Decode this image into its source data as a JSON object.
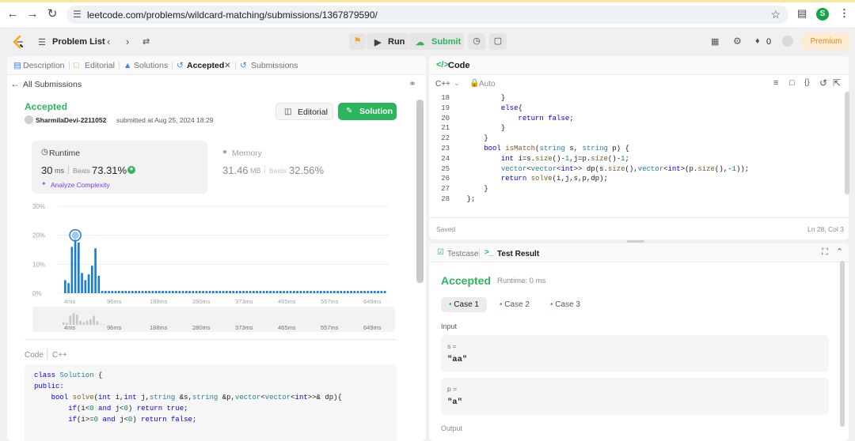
{
  "browser": {
    "url": "leetcode.com/problems/wildcard-matching/submissions/1367879590/",
    "profile_initial": "S"
  },
  "nav": {
    "problem_list": "Problem List",
    "run": "Run",
    "submit": "Submit",
    "streak": "0",
    "premium": "Premium"
  },
  "left_tabs": [
    {
      "label": "Description"
    },
    {
      "label": "Editorial"
    },
    {
      "label": "Solutions"
    },
    {
      "label": "Accepted"
    },
    {
      "label": "Submissions"
    }
  ],
  "submission": {
    "back": "All Submissions",
    "status": "Accepted",
    "user": "SharmilaDevi-2211052",
    "submitted": "submitted at Aug 25, 2024 18:29",
    "editorial_btn": "Editorial",
    "solution_btn": "Solution",
    "runtime_label": "Runtime",
    "runtime_value": "30",
    "runtime_unit": "ms",
    "beats_label": "Beats",
    "runtime_beats": "73.31%",
    "analyze": "Analyze Complexity",
    "memory_label": "Memory",
    "memory_value": "31.46",
    "memory_unit": "MB",
    "memory_beats": "32.56%"
  },
  "chart_data": {
    "type": "bar",
    "x_ticks": [
      "4ms",
      "96ms",
      "188ms",
      "280ms",
      "373ms",
      "465ms",
      "557ms",
      "649ms"
    ],
    "y_ticks": [
      "30%",
      "20%",
      "10%",
      "0%"
    ],
    "ylim": [
      0,
      30
    ],
    "values": [
      4.5,
      3.5,
      16,
      20,
      17.5,
      7,
      4.5,
      6.5,
      9.5,
      15.5,
      6,
      0.8,
      0.8,
      0.8,
      0.8,
      0.8,
      0.8,
      0.8,
      0.8,
      0.8,
      0.8,
      0.8,
      0.8,
      0.8,
      0.8,
      0.8,
      0.8,
      0.8,
      0.8,
      0.8,
      0.8,
      0.8,
      0.8,
      0.8,
      0.8,
      0.8,
      0.8,
      0.8,
      0.8,
      0.8,
      0.8,
      0.8,
      0.8,
      0.8,
      0.8,
      0.8,
      0.8,
      0.8,
      0.8,
      0.8,
      0.8,
      0.8,
      0.8,
      0.8,
      0.8,
      0.8,
      0.8,
      0.8,
      0.8,
      0.8,
      0.8,
      0.8,
      0.8,
      0.8,
      0.8,
      0.8,
      0.8,
      0.8,
      0.8,
      0.8,
      0.8,
      0.8,
      0.8,
      0.8,
      0.8,
      0.8,
      0.8,
      0.8,
      0.8,
      0.8,
      0.8,
      0.8,
      0.8,
      0.8,
      0.8,
      0.8,
      0.8,
      0.8,
      0.8,
      0.8,
      0.8,
      0.8,
      0.8,
      0.8,
      0.8,
      0.8
    ],
    "highlight_index": 3,
    "bar_color": "#1a7fd0"
  },
  "left_code": {
    "header_code": "Code",
    "header_lang": "C++",
    "lines": [
      [
        [
          "class ",
          "kw"
        ],
        [
          "Solution",
          "ty"
        ],
        [
          " {",
          "plain"
        ]
      ],
      [
        [
          "public:",
          "kw"
        ]
      ],
      [
        [
          "    ",
          "plain"
        ],
        [
          "bool ",
          "kw"
        ],
        [
          "solve",
          "fn"
        ],
        [
          "(",
          "plain"
        ],
        [
          "int ",
          "kw"
        ],
        [
          "i,",
          "plain"
        ],
        [
          "int ",
          "kw"
        ],
        [
          "j,",
          "plain"
        ],
        [
          "string ",
          "ty"
        ],
        [
          "&s,",
          "plain"
        ],
        [
          "string ",
          "ty"
        ],
        [
          "&p,",
          "plain"
        ],
        [
          "vector",
          "ty"
        ],
        [
          "<",
          "plain"
        ],
        [
          "vector",
          "ty"
        ],
        [
          "<",
          "plain"
        ],
        [
          "int",
          "kw"
        ],
        [
          ">>& dp){",
          "plain"
        ]
      ],
      [
        [
          "        ",
          "plain"
        ],
        [
          "if",
          "kw"
        ],
        [
          "(i<",
          "plain"
        ],
        [
          "0",
          "num"
        ],
        [
          " and ",
          "kw"
        ],
        [
          "j<",
          "plain"
        ],
        [
          "0",
          "num"
        ],
        [
          ") ",
          "plain"
        ],
        [
          "return ",
          "kw"
        ],
        [
          "true",
          "kw"
        ],
        [
          ";",
          "plain"
        ]
      ],
      [
        [
          "        ",
          "plain"
        ],
        [
          "if",
          "kw"
        ],
        [
          "(i>=",
          "plain"
        ],
        [
          "0",
          "num"
        ],
        [
          " and ",
          "kw"
        ],
        [
          "j<",
          "plain"
        ],
        [
          "0",
          "num"
        ],
        [
          ") ",
          "plain"
        ],
        [
          "return ",
          "kw"
        ],
        [
          "false",
          "kw"
        ],
        [
          ";",
          "plain"
        ]
      ]
    ]
  },
  "editor": {
    "title": "Code",
    "lang": "C++",
    "mode": "Auto",
    "saved": "Saved",
    "cursor": "Ln 28, Col 3",
    "lines": [
      {
        "n": "18",
        "t": [
          [
            "        }",
            "plain"
          ]
        ]
      },
      {
        "n": "19",
        "t": [
          [
            "        ",
            "plain"
          ],
          [
            "else",
            "kw"
          ],
          [
            "{",
            "plain"
          ]
        ]
      },
      {
        "n": "20",
        "t": [
          [
            "            ",
            "plain"
          ],
          [
            "return ",
            "kw"
          ],
          [
            "false",
            "kw"
          ],
          [
            ";",
            "plain"
          ]
        ]
      },
      {
        "n": "21",
        "t": [
          [
            "        }",
            "plain"
          ]
        ]
      },
      {
        "n": "22",
        "t": [
          [
            "    }",
            "plain"
          ]
        ]
      },
      {
        "n": "23",
        "t": [
          [
            "    ",
            "plain"
          ],
          [
            "bool ",
            "kw"
          ],
          [
            "isMatch",
            "fn"
          ],
          [
            "(",
            "plain"
          ],
          [
            "string ",
            "ty"
          ],
          [
            "s, ",
            "plain"
          ],
          [
            "string ",
            "ty"
          ],
          [
            "p) {",
            "plain"
          ]
        ]
      },
      {
        "n": "24",
        "t": [
          [
            "        ",
            "plain"
          ],
          [
            "int ",
            "kw"
          ],
          [
            "i=s.",
            "plain"
          ],
          [
            "size",
            "fn"
          ],
          [
            "()-",
            "plain"
          ],
          [
            "1",
            "num"
          ],
          [
            ",j=p.",
            "plain"
          ],
          [
            "size",
            "fn"
          ],
          [
            "()-",
            "plain"
          ],
          [
            "1",
            "num"
          ],
          [
            ";",
            "plain"
          ]
        ]
      },
      {
        "n": "25",
        "t": [
          [
            "        ",
            "plain"
          ],
          [
            "vector",
            "ty"
          ],
          [
            "<",
            "plain"
          ],
          [
            "vector",
            "ty"
          ],
          [
            "<",
            "plain"
          ],
          [
            "int",
            "kw"
          ],
          [
            ">> dp(s.",
            "plain"
          ],
          [
            "size",
            "fn"
          ],
          [
            "(),",
            "plain"
          ],
          [
            "vector",
            "ty"
          ],
          [
            "<",
            "plain"
          ],
          [
            "int",
            "kw"
          ],
          [
            ">(p.",
            "plain"
          ],
          [
            "size",
            "fn"
          ],
          [
            "(),-",
            "plain"
          ],
          [
            "1",
            "num"
          ],
          [
            "));",
            "plain"
          ]
        ]
      },
      {
        "n": "26",
        "t": [
          [
            "        ",
            "plain"
          ],
          [
            "return ",
            "kw"
          ],
          [
            "solve",
            "fn"
          ],
          [
            "(i,j,s,p,dp);",
            "plain"
          ]
        ]
      },
      {
        "n": "27",
        "t": [
          [
            "    }",
            "plain"
          ]
        ]
      },
      {
        "n": "28",
        "t": [
          [
            "};",
            "plain"
          ]
        ]
      }
    ]
  },
  "result": {
    "tab_testcase": "Testcase",
    "tab_result": "Test Result",
    "status": "Accepted",
    "runtime": "Runtime: 0 ms",
    "cases": [
      "Case 1",
      "Case 2",
      "Case 3"
    ],
    "input_label": "Input",
    "params": [
      {
        "name": "s =",
        "value": "\"aa\""
      },
      {
        "name": "p =",
        "value": "\"a\""
      }
    ],
    "output_label": "Output"
  }
}
